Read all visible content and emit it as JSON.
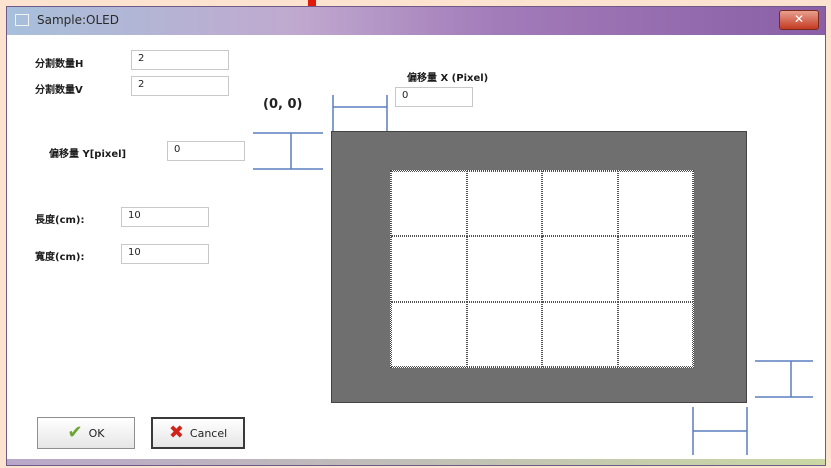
{
  "window": {
    "title": "Sample:OLED",
    "close_label": "✕"
  },
  "fields": {
    "divide_h": {
      "label": "分割数量H",
      "value": "2"
    },
    "divide_v": {
      "label": "分割数量V",
      "value": "2"
    },
    "offset_x": {
      "label": "偏移量 X (Pixel)",
      "value": "0"
    },
    "offset_y": {
      "label": "偏移量 Y[pixel]",
      "value": "0"
    },
    "length": {
      "label": "長度(cm):",
      "value": "10"
    },
    "width": {
      "label": "寬度(cm):",
      "value": "10"
    }
  },
  "origin_label": "(0, 0)",
  "preview": {
    "rows": 3,
    "cols": 4
  },
  "buttons": {
    "ok": "OK",
    "cancel": "Cancel"
  },
  "colors": {
    "preview_bg": "#6f6f6f",
    "marker": "#5b7fbf",
    "title_accent": "#e0190b"
  }
}
